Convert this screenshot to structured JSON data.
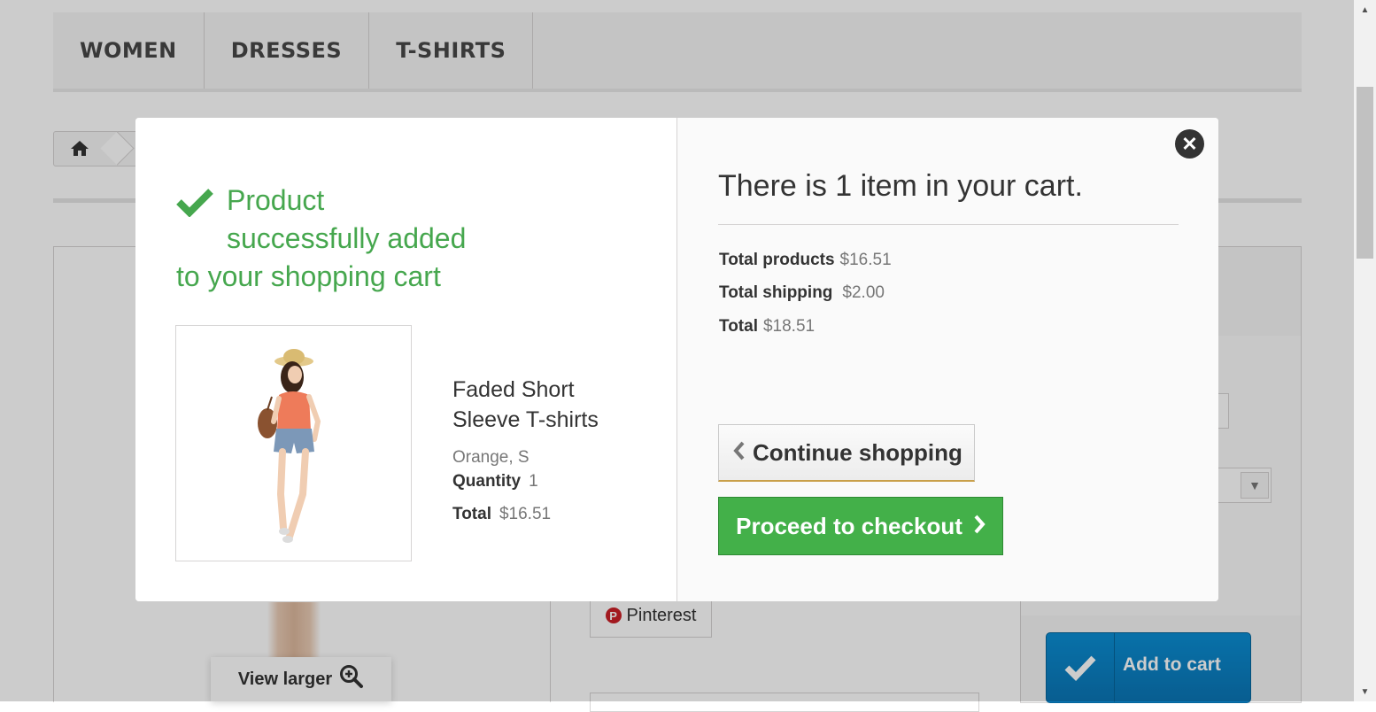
{
  "nav": {
    "items": [
      "WOMEN",
      "DRESSES",
      "T-SHIRTS"
    ]
  },
  "page": {
    "view_larger": "View larger",
    "pinterest": "Pinterest",
    "add_to_cart": "Add to cart"
  },
  "modal": {
    "success": {
      "line1": "Product",
      "line2": "successfully added",
      "line3": "to your shopping cart"
    },
    "product": {
      "name": "Faded Short Sleeve T-shirts",
      "attributes": "Orange, S",
      "quantity_label": "Quantity",
      "quantity_value": "1",
      "total_label": "Total",
      "total_value": "$16.51"
    },
    "cart": {
      "count_text": "There is 1 item in your cart.",
      "total_products_label": "Total products",
      "total_products_value": "$16.51",
      "total_shipping_label": "Total shipping",
      "total_shipping_value": "$2.00",
      "total_label": "Total",
      "total_value": "$18.51"
    },
    "buttons": {
      "continue": "Continue shopping",
      "checkout": "Proceed to checkout"
    }
  },
  "colors": {
    "success_green": "#46a74e",
    "checkout_green": "#43b049",
    "add_to_cart_blue": "#0b8ed4"
  }
}
